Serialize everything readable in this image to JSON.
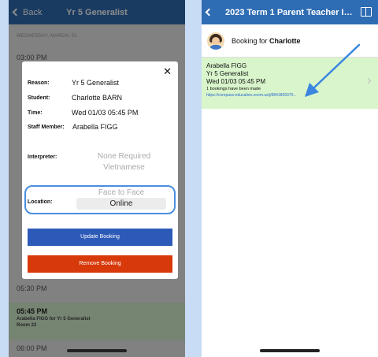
{
  "left": {
    "nav": {
      "back_label": "Back",
      "title": "Yr 5 Generalist"
    },
    "day_header": "WEDNESDAY, MARCH, 01",
    "slots": [
      {
        "time": "03:00 PM"
      },
      {
        "time": "05:30 PM"
      },
      {
        "time": "05:45 PM",
        "line2": "Arabella FIGG for Yr 5 Generalist",
        "line3": "Room 22"
      },
      {
        "time": "06:00 PM"
      }
    ],
    "modal": {
      "close_symbol": "✕",
      "reason_label": "Reason:",
      "reason_value": "Yr 5 Generalist",
      "student_label": "Student:",
      "student_value": "Charlotte BARN",
      "time_label": "Time:",
      "time_value": "Wed 01/03 05:45 PM",
      "staff_label": "Staff Member:",
      "staff_value": "Arabella FIGG",
      "interpreter_label": "Interpreter:",
      "interpreter_options": [
        "None Required",
        "Vietnamese"
      ],
      "location_label": "Location:",
      "location_options": [
        "Face to Face",
        "Online"
      ],
      "location_selected": "Online",
      "update_label": "Update Booking",
      "remove_label": "Remove Booking"
    }
  },
  "right": {
    "nav": {
      "title": "2023 Term 1 Parent Teacher Inte..."
    },
    "booking_prefix": "Booking for ",
    "booking_name": "Charlotte",
    "card": {
      "teacher": "Arabella FIGG",
      "subject": "Yr 5 Generalist",
      "time": "Wed 01/03 05:45 PM",
      "count": "1 bookings have been made",
      "link": "https://compass-education.zoom.us/j/8841869370..."
    }
  },
  "colors": {
    "nav_blue": "#2e6cb3",
    "update_button": "#2d5ab8",
    "remove_button": "#d7390b",
    "card_green": "#d9f5cb",
    "arrow_blue": "#3a86e0",
    "background": "#c9dcf6"
  }
}
